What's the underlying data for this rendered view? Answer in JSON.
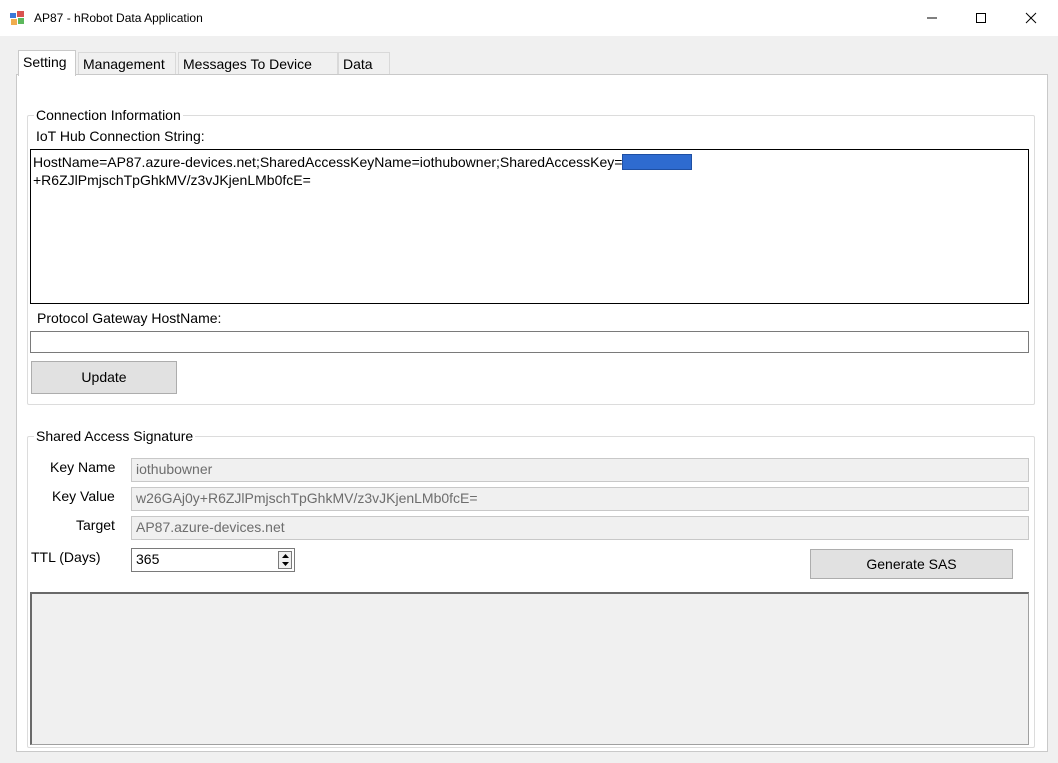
{
  "window": {
    "title": "AP87 - hRobot Data Application"
  },
  "tabs": [
    {
      "label": "Setting",
      "active": true
    },
    {
      "label": "Management",
      "active": false
    },
    {
      "label": "Messages To Device",
      "active": false
    },
    {
      "label": "Data",
      "active": false
    }
  ],
  "connection": {
    "group_title": "Connection Information",
    "conn_label": "IoT Hub Connection String:",
    "conn_value_line1": "HostName=AP87.azure-devices.net;SharedAccessKeyName=iothubowner;SharedAccessKey=",
    "conn_value_line2": "+R6ZJlPmjschTpGhkMV/z3vJKjenLMb0fcE=",
    "gateway_label": "Protocol Gateway HostName:",
    "gateway_value": "",
    "update_label": "Update"
  },
  "sas": {
    "group_title": "Shared Access Signature",
    "key_name_label": "Key Name",
    "key_name_value": "iothubowner",
    "key_value_label": "Key Value",
    "key_value_value": "w26GAj0y+R6ZJlPmjschTpGhkMV/z3vJKjenLMb0fcE=",
    "target_label": "Target",
    "target_value": "AP87.azure-devices.net",
    "ttl_label": "TTL (Days)",
    "ttl_value": "365",
    "generate_label": "Generate SAS",
    "output_value": ""
  },
  "colors": {
    "key_mask": "#2e6bd0"
  }
}
